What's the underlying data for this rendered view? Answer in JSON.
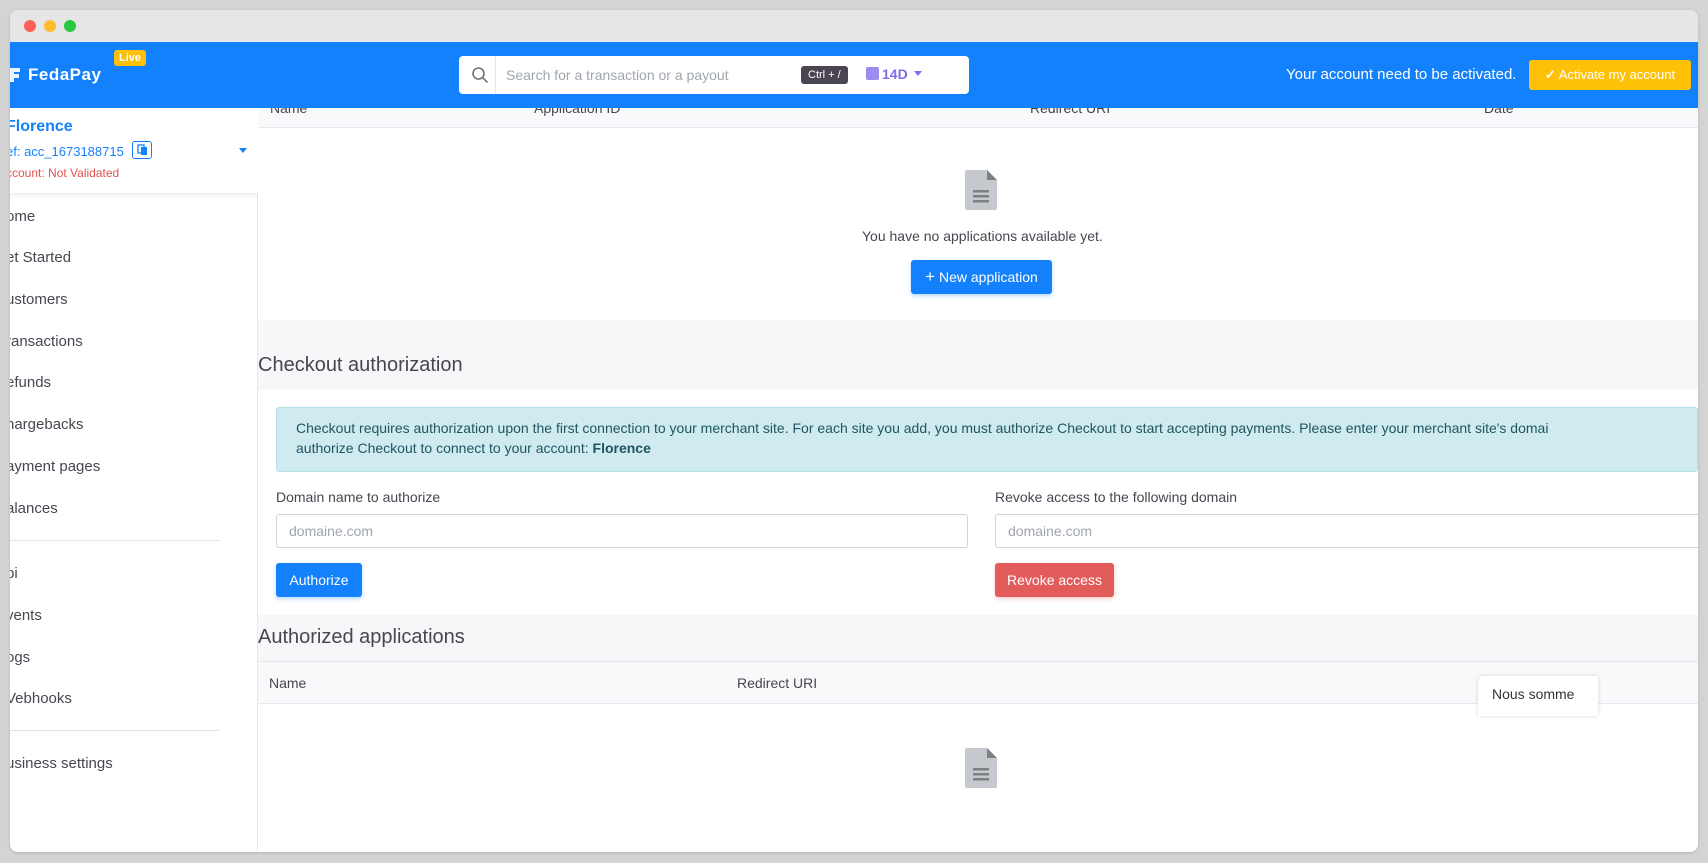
{
  "topbar": {
    "brand_name": "FedaPay",
    "live_badge": "Live",
    "search_placeholder": "Search for a transaction or a payout",
    "search_shortcut": "Ctrl + /",
    "period": "14D",
    "activation_text": "Your account need to be activated.",
    "activate_button": "Activate my account"
  },
  "account": {
    "name": "Florence",
    "ref": "ef: acc_1673188715",
    "status": "ccount: Not Validated"
  },
  "sidebar": {
    "items": [
      {
        "label": "ome"
      },
      {
        "label": "et Started"
      },
      {
        "label": "ustomers"
      },
      {
        "label": "ransactions"
      },
      {
        "label": "efunds"
      },
      {
        "label": "hargebacks"
      },
      {
        "label": "ayment pages"
      },
      {
        "label": "alances"
      },
      {
        "label": "pi"
      },
      {
        "label": "vents"
      },
      {
        "label": "ogs"
      },
      {
        "label": "Vebhooks"
      },
      {
        "label": "usiness settings"
      }
    ]
  },
  "applications": {
    "columns": [
      "Name",
      "Application ID",
      "Redirect URI",
      "Date"
    ],
    "empty_text": "You have no applications available yet.",
    "new_button": "New application"
  },
  "checkout": {
    "title": "Checkout authorization",
    "info_line1": "Checkout requires authorization upon the first connection to your merchant site. For each site you add, you must authorize Checkout to start accepting payments. Please enter your merchant site's domai",
    "info_line2_prefix": "authorize Checkout to connect to your account: ",
    "info_account": "Florence",
    "domain_label": "Domain name to authorize",
    "domain_placeholder": "domaine.com",
    "authorize_button": "Authorize",
    "revoke_label": "Revoke access to the following domain",
    "revoke_placeholder": "domaine.com",
    "revoke_button": "Revoke access"
  },
  "authorized": {
    "title": "Authorized applications",
    "columns": [
      "Name",
      "Redirect URI"
    ]
  },
  "chat": {
    "label": "Nous somme"
  },
  "colors": {
    "primary": "#1481fc",
    "warning": "#ffc107",
    "danger": "#e25c5c",
    "info_bg": "#d0ebf0"
  }
}
